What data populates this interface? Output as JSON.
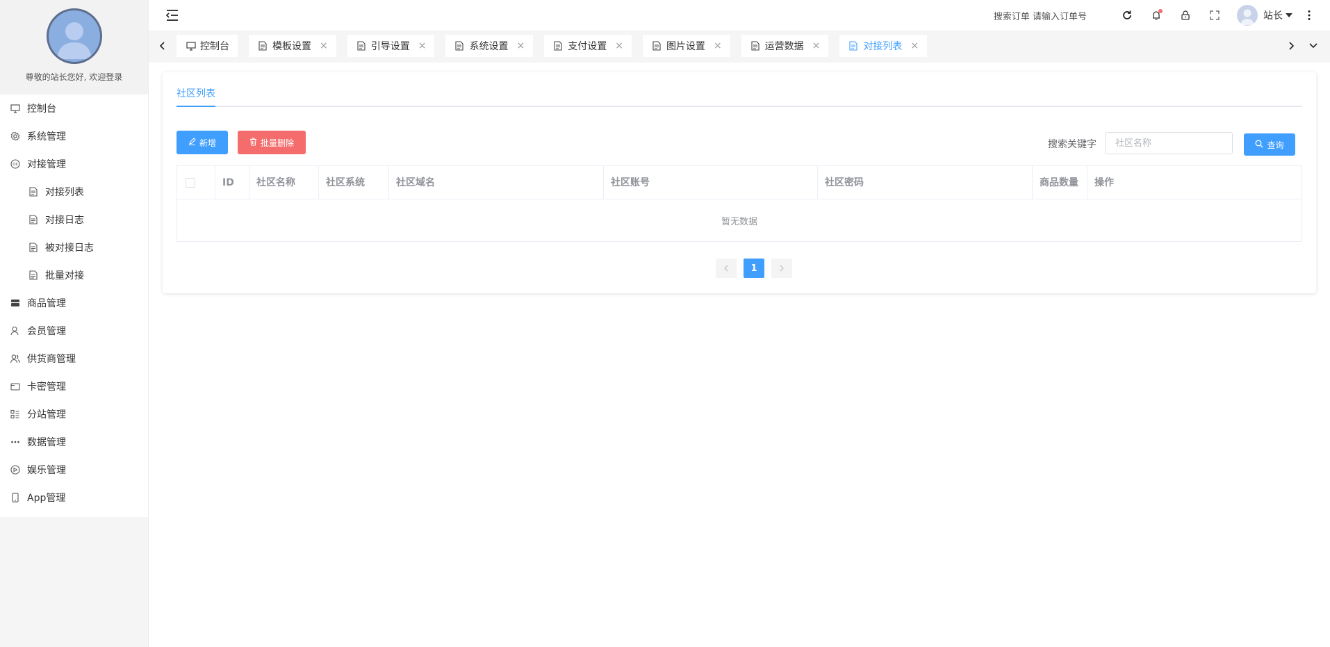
{
  "sidebar": {
    "welcome": "尊敬的站长您好, 欢迎登录",
    "items": [
      {
        "label": "控制台",
        "icon": "monitor-icon"
      },
      {
        "label": "系统管理",
        "icon": "gear-icon"
      },
      {
        "label": "对接管理",
        "icon": "ok-icon"
      },
      {
        "label": "对接列表",
        "icon": "document-icon"
      },
      {
        "label": "对接日志",
        "icon": "document-icon"
      },
      {
        "label": "被对接日志",
        "icon": "document-icon"
      },
      {
        "label": "批量对接",
        "icon": "document-icon"
      },
      {
        "label": "商品管理",
        "icon": "goods-icon"
      },
      {
        "label": "会员管理",
        "icon": "user-icon"
      },
      {
        "label": "供货商管理",
        "icon": "users-icon"
      },
      {
        "label": "卡密管理",
        "icon": "card-icon"
      },
      {
        "label": "分站管理",
        "icon": "branch-icon"
      },
      {
        "label": "数据管理",
        "icon": "dots-icon"
      },
      {
        "label": "娱乐管理",
        "icon": "game-icon"
      },
      {
        "label": "App管理",
        "icon": "mobile-icon"
      }
    ]
  },
  "header": {
    "search_order": "搜索订单 请输入订单号",
    "user_name": "站长"
  },
  "tabs": [
    {
      "label": "控制台"
    },
    {
      "label": "模板设置"
    },
    {
      "label": "引导设置"
    },
    {
      "label": "系统设置"
    },
    {
      "label": "支付设置"
    },
    {
      "label": "图片设置"
    },
    {
      "label": "运营数据"
    },
    {
      "label": "对接列表"
    }
  ],
  "main": {
    "card_tab": "社区列表",
    "add_label": "新增",
    "batch_delete_label": "批量删除",
    "search_label": "搜索关键字",
    "search_placeholder": "社区名称",
    "query_label": "查询",
    "columns": [
      "ID",
      "社区名称",
      "社区系统",
      "社区域名",
      "社区账号",
      "社区密码",
      "商品数量",
      "操作"
    ],
    "empty_text": "暂无数据",
    "pagination": {
      "current_page": "1"
    }
  },
  "colors": {
    "primary": "#409eff",
    "danger": "#f56c6c"
  }
}
